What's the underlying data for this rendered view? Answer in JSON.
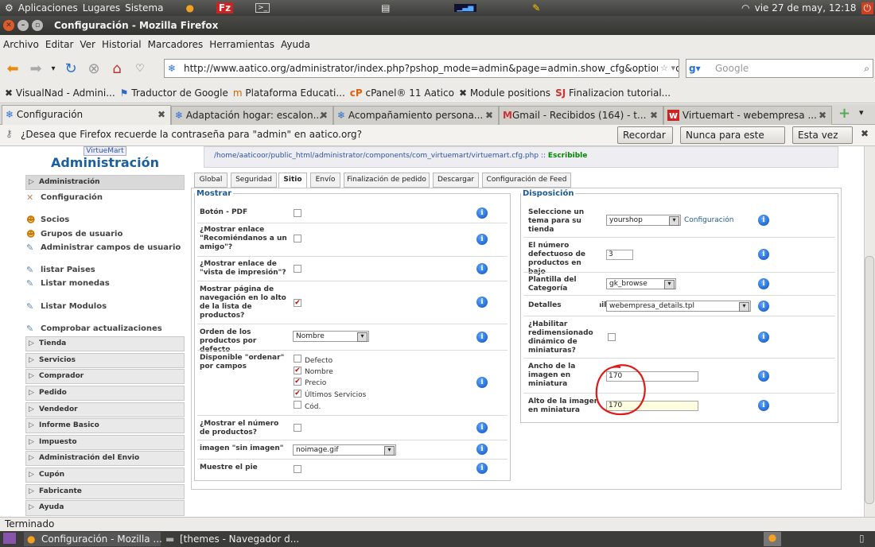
{
  "top_panel": {
    "apps": "Aplicaciones",
    "places": "Lugares",
    "system": "Sistema",
    "clock": "vie 27 de may, 12:18"
  },
  "window": {
    "title": "Configuración - Mozilla Firefox"
  },
  "menubar": {
    "items": [
      "Archivo",
      "Editar",
      "Ver",
      "Historial",
      "Marcadores",
      "Herramientas",
      "Ayuda"
    ]
  },
  "navbar": {
    "url": "http://www.aatico.org/administrator/index.php?pshop_mode=admin&page=admin.show_cfg&option=co",
    "search_placeholder": "Google"
  },
  "bookmarks": [
    "VisualNad - Admini...",
    "Traductor de Google",
    "Plataforma Educati...",
    "cPanel® 11 Aatico",
    "Module positions",
    "Finalizacion tutorial..."
  ],
  "tabs": [
    "Configuración",
    "Adaptación hogar: escalon...",
    "Acompañamiento persona...",
    "Gmail - Recibidos (164) - t...",
    "Virtuemart - webempresa ..."
  ],
  "notification": {
    "text": "¿Desea que Firefox recuerde la contraseña para \"admin\" en aatico.org?",
    "remember": "Recordar",
    "never": "Nunca para este sitio",
    "not_now": "Esta vez no"
  },
  "sidebar": {
    "brand_badge": "VirtueMart",
    "brand": "Administración",
    "admin_header": "Administración",
    "admin_items": [
      "Configuración",
      "Socios",
      "Grupos de usuario",
      "Administrar campos de usuario",
      "listar Paises",
      "Listar monedas",
      "Listar Modulos",
      "Comprobar actualizaciones"
    ],
    "sections": [
      "Tienda",
      "Servicios",
      "Comprador",
      "Pedido",
      "Vendedor",
      "Informe Basico",
      "Impuesto",
      "Administración del Envio",
      "Cupón",
      "Fabricante",
      "Ayuda"
    ]
  },
  "path": {
    "file": "/home/aaticoor/public_html/administrator/components/com_virtuemart/virtuemart.cfg.php",
    "sep": " :: ",
    "status": "Escribible"
  },
  "page_tabs": [
    "Global",
    "Seguridad",
    "Sitio",
    "Envío",
    "Finalización de pedido",
    "Descargar",
    "Configuración de Feed"
  ],
  "mostrar": {
    "legend": "Mostrar",
    "pdf": "Botón - PDF",
    "recommend": "¿Mostrar enlace \"Recomiéndanos a un amigo\"?",
    "print": "¿Mostrar enlace de \"vista de impresión\"?",
    "nav": "Mostrar página de navegación en lo alto de la lista de productos?",
    "order_label": "Orden de los productos por defecto",
    "order_value": "Nombre",
    "sort_label": "Disponible \"ordenar\" por campos",
    "sort_options": [
      "Defecto",
      "Nombre",
      "Precio",
      "Últimos Servicios",
      "Cód."
    ],
    "count": "¿Mostrar el número de productos?",
    "noimg_label": "imagen \"sin imagen\"",
    "noimg_value": "noimage.gif",
    "footer": "Muestre el pie"
  },
  "disposicion": {
    "legend": "Disposición",
    "theme_label": "Seleccione un tema para su tienda",
    "theme_value": "yourshop",
    "theme_link": "Configuración",
    "perrow_label": "El número defectuoso de productos en bajo",
    "perrow_value": "3",
    "cat_label": "Plantilla del Categoría",
    "cat_value": "gk_browse",
    "details_label": "Detalles",
    "details_value": "webempresa_details.tpl",
    "resize_label": "¿Habilitar redimensionado dinámico de miniaturas?",
    "width_label": "Ancho de la imagen en miniatura",
    "width_value": "170",
    "height_label": "Alto de la imagen en miniatura",
    "height_value": "170"
  },
  "status_text": "Terminado",
  "taskbar": [
    "Configuración - Mozilla ...",
    "[themes - Navegador d..."
  ]
}
